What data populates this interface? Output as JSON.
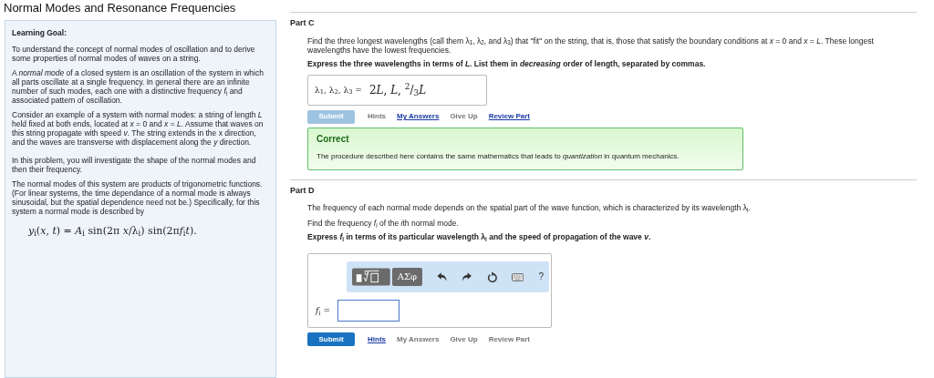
{
  "title": "Normal Modes and Resonance Frequencies",
  "goal": {
    "heading": "Learning Goal:",
    "paragraphs": [
      "To understand the concept of normal modes of oscillation and to derive some properties of normal modes of waves on a string.",
      "A *normal mode* of a closed system is an oscillation of the system in which all parts oscillate at a single frequency. In general there are an infinite number of such modes, each one with a distinctive frequency *f*$_{i}$ and associated pattern of oscillation.",
      "Consider an example of a system with normal modes: a string of length *L* held fixed at both ends, located at *x* = 0 and *x* = *L*. Assume that waves on this string propagate with speed *v*. The string extends in the x direction, and the waves are transverse with displacement along the *y* direction.",
      "In this problem, you will investigate the shape of the normal modes and then their frequency.",
      "The normal modes of this system are products of trigonometric functions. (For linear systems, the time dependance of a normal mode is always sinusoidal, but the spatial dependence need not be.) Specifically, for this system a normal mode is described by"
    ],
    "equation": [
      {
        "t": "y",
        "italic": true
      },
      {
        "t": "i",
        "sub": true
      },
      {
        "t": "("
      },
      {
        "t": "x",
        "italic": true
      },
      {
        "t": ", "
      },
      {
        "t": "t",
        "italic": true
      },
      {
        "t": ") = "
      },
      {
        "t": "A",
        "italic": true
      },
      {
        "t": "i",
        "sub": true
      },
      {
        "t": " sin(2π "
      },
      {
        "t": "x",
        "italic": true
      },
      {
        "t": "/λ"
      },
      {
        "t": "i",
        "sub": true
      },
      {
        "t": ") sin(2π"
      },
      {
        "t": "f",
        "italic": true
      },
      {
        "t": "i",
        "sub": true
      },
      {
        "t": "t",
        "italic": true
      },
      {
        "t": ")."
      }
    ]
  },
  "parts": [
    {
      "label": "Part C",
      "paragraphs": [
        "Find the three longest wavelengths (call them λ$_{1}$, λ$_{2}$, and λ$_{3}$) that \"fit\" on the string, that is, those that satisfy the boundary conditions at *x* = 0 and *x* = *L*. These longest wavelengths have the lowest frequencies."
      ],
      "instruction": "Express the three wavelengths in terms of *L*. List them in *decreasing* order of length, separated by commas.",
      "answer": {
        "kind": "display",
        "prefix": "λ$_{1}$, λ$_{2}$, λ$_{3}$ =",
        "value": [
          {
            "t": "2"
          },
          {
            "t": "L",
            "italic": true
          },
          {
            "t": ", "
          },
          {
            "t": "L",
            "italic": true
          },
          {
            "t": ", "
          },
          {
            "t": "2",
            "sup": true
          },
          {
            "t": "/"
          },
          {
            "t": "3",
            "sub": true
          },
          {
            "t": "L",
            "italic": true
          }
        ]
      },
      "submit": {
        "label": "Submit",
        "disabled": true
      },
      "links": [
        {
          "label": "Hints",
          "link": false
        },
        {
          "label": "My Answers",
          "link": true
        },
        {
          "label": "Give Up",
          "link": false
        },
        {
          "label": "Review Part",
          "link": true
        }
      ],
      "feedback": {
        "title": "Correct",
        "text": "The procedure described here contains the same mathematics that leads to *quantization* in quantum mechanics."
      }
    },
    {
      "label": "Part D",
      "paragraphs": [
        "The frequency of each normal mode depends on the spatial part of the wave function, which is characterized by its wavelength λ$_{i}$.",
        [
          {
            "t": "Find the frequency "
          },
          {
            "t": "f",
            "italic": true
          },
          {
            "t": "i",
            "sub": true
          },
          {
            "t": " of the "
          },
          {
            "t": "i",
            "italic": true
          },
          {
            "t": "th normal mode."
          }
        ]
      ],
      "instruction": "Express *f*$_{i}$ in terms of its particular wavelength λ$_{i}$ and the speed of propagation of the wave *v*.",
      "answer": {
        "kind": "editor",
        "prefix": "*f*$_{i}$ =",
        "tools": [
          {
            "kind": "template"
          },
          {
            "kind": "text",
            "label": "ΑΣφ"
          },
          {
            "kind": "undo"
          },
          {
            "kind": "redo"
          },
          {
            "kind": "reset"
          },
          {
            "kind": "keyboard"
          },
          {
            "kind": "help",
            "label": "?"
          }
        ]
      },
      "submit": {
        "label": "Submit",
        "disabled": false
      },
      "links": [
        {
          "label": "Hints",
          "link": true
        },
        {
          "label": "My Answers",
          "link": false
        },
        {
          "label": "Give Up",
          "link": false
        },
        {
          "label": "Review Part",
          "link": false
        }
      ]
    }
  ]
}
